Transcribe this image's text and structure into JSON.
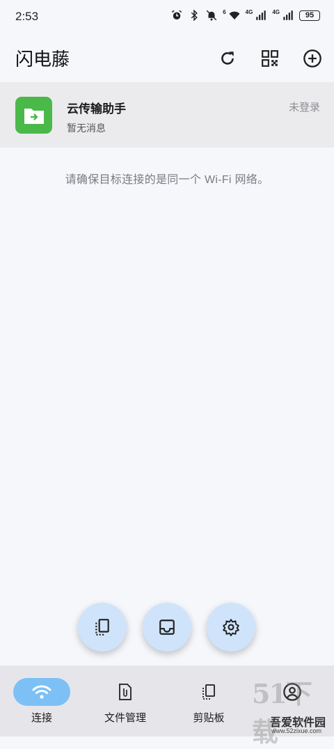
{
  "status_bar": {
    "time": "2:53",
    "signal1_label": "4G",
    "signal2_label": "4G",
    "wifi_label": "6",
    "battery": "95"
  },
  "header": {
    "title": "闪电藤",
    "icons": [
      "refresh-icon",
      "qr-code-icon",
      "add-circle-icon"
    ]
  },
  "device": {
    "name": "云传输助手",
    "subtitle": "暂无消息",
    "status": "未登录",
    "icon_color": "#4bb84a"
  },
  "hint": "请确保目标连接的是同一个 Wi-Fi 网络。",
  "fabs": [
    "clipboard-icon",
    "inbox-icon",
    "settings-icon"
  ],
  "bottom_nav": {
    "items": [
      {
        "label": "连接",
        "icon": "wifi-icon",
        "active": true
      },
      {
        "label": "文件管理",
        "icon": "file-icon"
      },
      {
        "label": "剪贴板",
        "icon": "clipboard-icon"
      },
      {
        "label": "",
        "icon": "account-icon"
      }
    ]
  },
  "watermark": {
    "text": "吾爱软件园",
    "url": "www.52zixue.com"
  },
  "colors": {
    "accent": "#7cc0f6",
    "fab_bg": "#cfe3fb",
    "background": "#f5f7fb"
  }
}
